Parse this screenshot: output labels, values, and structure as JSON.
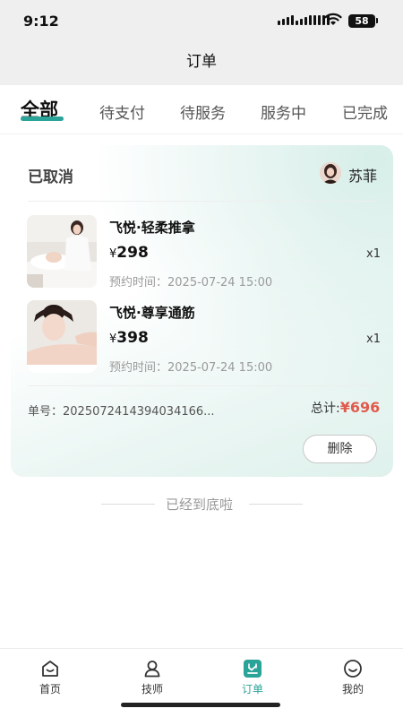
{
  "status_bar": {
    "time": "9:12",
    "battery": "58"
  },
  "nav": {
    "title": "订单"
  },
  "tabs": [
    {
      "label": "全部",
      "active": true
    },
    {
      "label": "待支付"
    },
    {
      "label": "待服务"
    },
    {
      "label": "服务中"
    },
    {
      "label": "已完成"
    }
  ],
  "order": {
    "status": "已取消",
    "technician": {
      "name": "苏菲"
    },
    "items": [
      {
        "name": "飞悦·轻柔推拿",
        "currency": "¥",
        "price": "298",
        "qty": "x1",
        "time": "预约时间：2025-07-24 15:00"
      },
      {
        "name": "飞悦·尊享通筋",
        "currency": "¥",
        "price": "398",
        "qty": "x1",
        "time": "预约时间：2025-07-24 15:00"
      }
    ],
    "order_no": "单号：2025072414394034166...",
    "total_label": "总计:",
    "total_amount": "¥696",
    "delete_label": "删除"
  },
  "list_end": "已经到底啦",
  "bottom_nav": [
    {
      "label": "首页",
      "icon": "home-icon"
    },
    {
      "label": "技师",
      "icon": "technician-icon"
    },
    {
      "label": "订单",
      "icon": "order-icon",
      "active": true
    },
    {
      "label": "我的",
      "icon": "profile-icon"
    }
  ],
  "colors": {
    "accent": "#2aa398",
    "price_red": "#e05b4d"
  }
}
